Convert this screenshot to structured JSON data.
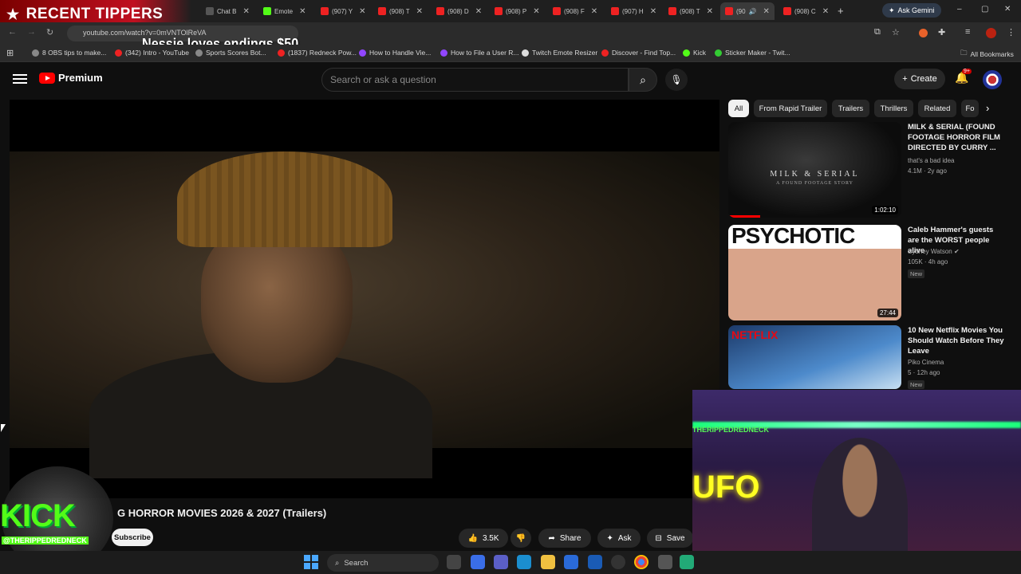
{
  "overlay": {
    "recent_tippers": "RECENT TIPPERS",
    "tip_message": "Nessie loves endings $50"
  },
  "browser": {
    "tabs": [
      {
        "label": "Chat B"
      },
      {
        "label": "Emote"
      },
      {
        "label": "(907) Y"
      },
      {
        "label": "(908) T"
      },
      {
        "label": "(908) D"
      },
      {
        "label": "(908) P"
      },
      {
        "label": "(908) F"
      },
      {
        "label": "(907) H"
      },
      {
        "label": "(908) T"
      },
      {
        "label": "(90"
      },
      {
        "label": "(908) C"
      }
    ],
    "ask_gemini": "Ask Gemini",
    "url": "youtube.com/watch?v=0mVNTOlReVA",
    "bookmarks": [
      {
        "label": "8 OBS tips to make..."
      },
      {
        "label": "(342) Intro - YouTube"
      },
      {
        "label": "Sports Scores Bot..."
      },
      {
        "label": "(1837) Redneck Pow..."
      },
      {
        "label": "How to Handle Vie..."
      },
      {
        "label": "How to File a User R..."
      },
      {
        "label": "Twitch Emote Resizer"
      },
      {
        "label": "Discover - Find Top..."
      },
      {
        "label": "Kick"
      },
      {
        "label": "Sticker Maker - Twit..."
      }
    ],
    "all_bookmarks": "All Bookmarks"
  },
  "youtube": {
    "logo_text": "Premium",
    "search_placeholder": "Search or ask a question",
    "create_label": "Create",
    "notif_badge": "9+",
    "chips": [
      "All",
      "From Rapid Trailer",
      "Trailers",
      "Thrillers",
      "Related",
      "Fo"
    ],
    "video_title": "G HORROR MOVIES 2026 & 2027 (Trailers)",
    "subscribe_label": "Subscribe",
    "likes": "3.5K",
    "share_label": "Share",
    "ask_label": "Ask",
    "save_label": "Save",
    "recommendations": [
      {
        "title": "MILK & SERIAL (FOUND FOOTAGE HORROR FILM DIRECTED BY CURRY ...",
        "channel": "that's a bad idea",
        "meta": "4.1M · 2y ago",
        "duration": "1:02:10",
        "thumb_text": "MILK & SERIAL",
        "thumb_sub": "A FOUND FOOTAGE STORY",
        "badge": ""
      },
      {
        "title": "Caleb Hammer's guests are the WORST people alive",
        "channel": "Sydney Watson",
        "meta": "105K · 4h ago",
        "duration": "27:44",
        "thumb_text": "PSYCHOTIC",
        "thumb_sub": "",
        "badge": "New"
      },
      {
        "title": "10 New Netflix Movies You Should Watch Before They Leave",
        "channel": "Piko Cinema",
        "meta": "5 · 12h ago",
        "duration": "",
        "thumb_text": "NETFLIX",
        "thumb_sub": "",
        "badge": "New"
      }
    ]
  },
  "kick_overlay": {
    "word": "KICK",
    "handle": "@THERIPPEDREDNECK"
  },
  "webcam": {
    "sign": "THERIPPEDREDNECK",
    "ufo": "UFO"
  },
  "taskbar": {
    "search_label": "Search"
  }
}
